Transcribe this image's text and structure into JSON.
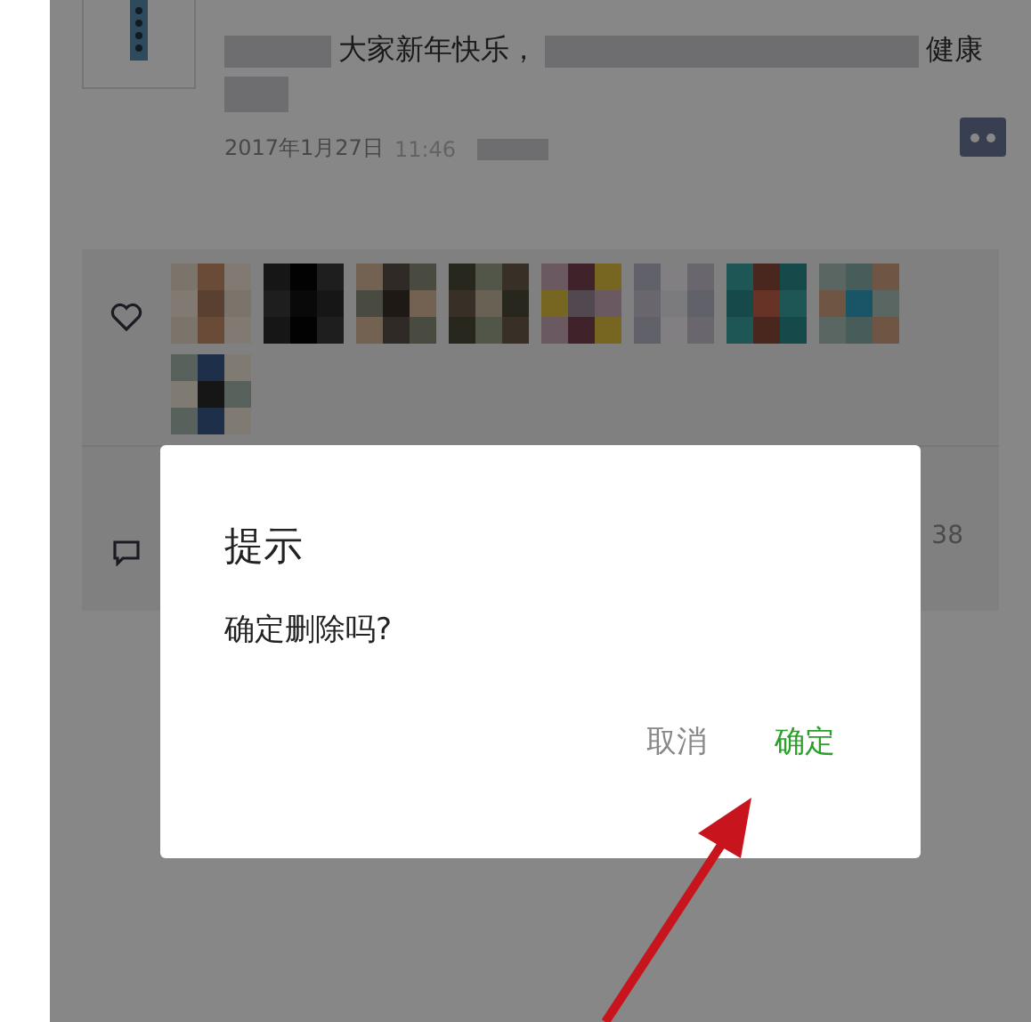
{
  "post": {
    "text_start": "大家新年快乐，",
    "text_end": "健康",
    "date": "2017年1月27日",
    "time": "11:46"
  },
  "comments": {
    "count": "38"
  },
  "dialog": {
    "title": "提示",
    "message": "确定删除吗?",
    "buttons": [
      {
        "label": "取消",
        "kind": "cancel"
      },
      {
        "label": "确定",
        "kind": "confirm"
      }
    ]
  }
}
